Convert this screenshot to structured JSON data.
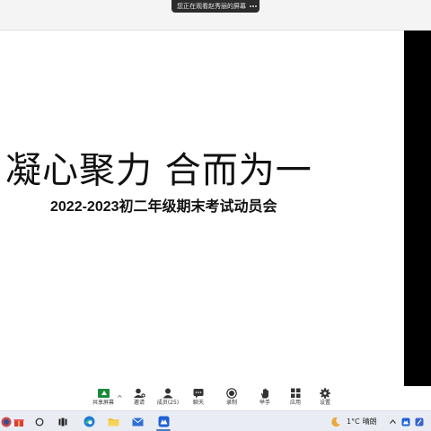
{
  "banner": {
    "text": "您正在观看赵秀丽的屏幕"
  },
  "slide": {
    "title": "凝心聚力  合而为一",
    "subtitle": "2022-2023初二年级期末考试动员会"
  },
  "toolbar": {
    "items": [
      {
        "label": "共享屏幕",
        "icon": "share-screen-icon"
      },
      {
        "label": "邀请",
        "icon": "invite-icon"
      },
      {
        "label": "成员(25)",
        "icon": "members-icon"
      },
      {
        "label": "聊天",
        "icon": "chat-icon"
      },
      {
        "label": "录制",
        "icon": "record-icon"
      },
      {
        "label": "举手",
        "icon": "raise-hand-icon"
      },
      {
        "label": "应用",
        "icon": "apps-icon"
      },
      {
        "label": "设置",
        "icon": "settings-icon"
      }
    ]
  },
  "taskbar": {
    "weather": {
      "temp": "1°C",
      "condition": "晴朗",
      "icon": "moon-icon"
    },
    "apps": [
      "start-icon",
      "gift-icon",
      "search-icon",
      "task-view-icon",
      "edge-icon",
      "file-explorer-icon",
      "mail-icon",
      "meeting-app-icon"
    ]
  },
  "colors": {
    "share_green": "#1a8a3a",
    "taskbar_bg": "#e9edf3"
  }
}
